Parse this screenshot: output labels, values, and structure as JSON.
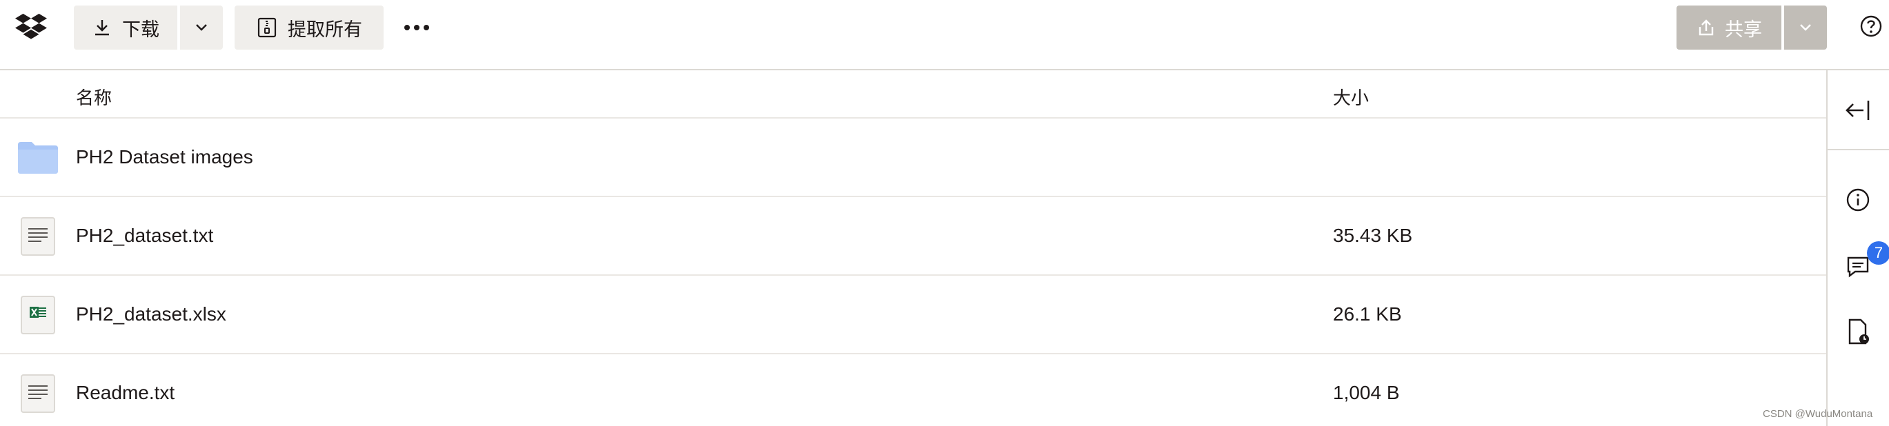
{
  "toolbar": {
    "download_label": "下载",
    "extract_label": "提取所有",
    "share_label": "共享"
  },
  "table": {
    "headers": {
      "name": "名称",
      "size": "大小"
    },
    "rows": [
      {
        "name": "PH2 Dataset images",
        "size": "",
        "icon": "folder-icon"
      },
      {
        "name": "PH2_dataset.txt",
        "size": "35.43 KB",
        "icon": "text-file-icon"
      },
      {
        "name": "PH2_dataset.xlsx",
        "size": "26.1 KB",
        "icon": "excel-file-icon"
      },
      {
        "name": "Readme.txt",
        "size": "1,004 B",
        "icon": "text-file-icon"
      }
    ]
  },
  "right_panel": {
    "comments_badge": "7"
  },
  "colors": {
    "accent": "#2f6fec",
    "folder": "#a9c6f7",
    "button_bg": "#f0eeeb",
    "disabled_button": "#c1bdb7"
  },
  "watermark": "CSDN @WuduMontana"
}
